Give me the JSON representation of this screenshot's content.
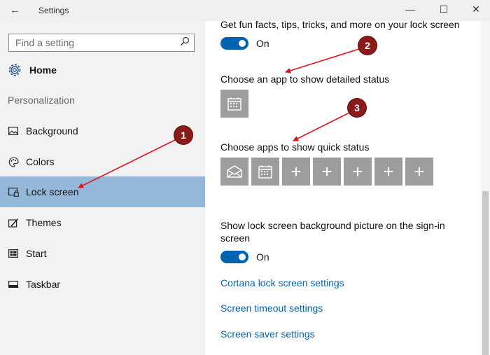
{
  "window": {
    "title": "Settings",
    "back_glyph": "←",
    "minimize_glyph": "—",
    "maximize_glyph": "☐",
    "close_glyph": "✕"
  },
  "sidebar": {
    "search_placeholder": "Find a setting",
    "home_label": "Home",
    "section_label": "Personalization",
    "items": [
      {
        "label": "Background",
        "icon": "picture-icon"
      },
      {
        "label": "Colors",
        "icon": "palette-icon"
      },
      {
        "label": "Lock screen",
        "icon": "lock-screen-icon",
        "selected": true
      },
      {
        "label": "Themes",
        "icon": "themes-icon"
      },
      {
        "label": "Start",
        "icon": "start-icon"
      },
      {
        "label": "Taskbar",
        "icon": "taskbar-icon"
      }
    ]
  },
  "content": {
    "fun_facts_label": "Get fun facts, tips, tricks, and more on your lock screen",
    "fun_facts_toggle": "On",
    "detailed_status_label": "Choose an app to show detailed status",
    "quick_status_label": "Choose apps to show quick status",
    "quick_status_tiles": [
      "mail-icon",
      "calendar-icon",
      "plus-icon",
      "plus-icon",
      "plus-icon",
      "plus-icon",
      "plus-icon"
    ],
    "signin_label_line1": "Show lock screen background picture on the sign-in",
    "signin_label_line2": "screen",
    "signin_toggle": "On",
    "links": [
      "Cortana lock screen settings",
      "Screen timeout settings",
      "Screen saver settings"
    ]
  },
  "annotations": [
    "1",
    "2",
    "3"
  ],
  "colors": {
    "accent": "#0063b1",
    "selected_nav": "#93b8d9",
    "tile": "#9d9d9d",
    "annotation_badge": "#8b1a1a",
    "annotation_arrow": "#e0141e"
  }
}
